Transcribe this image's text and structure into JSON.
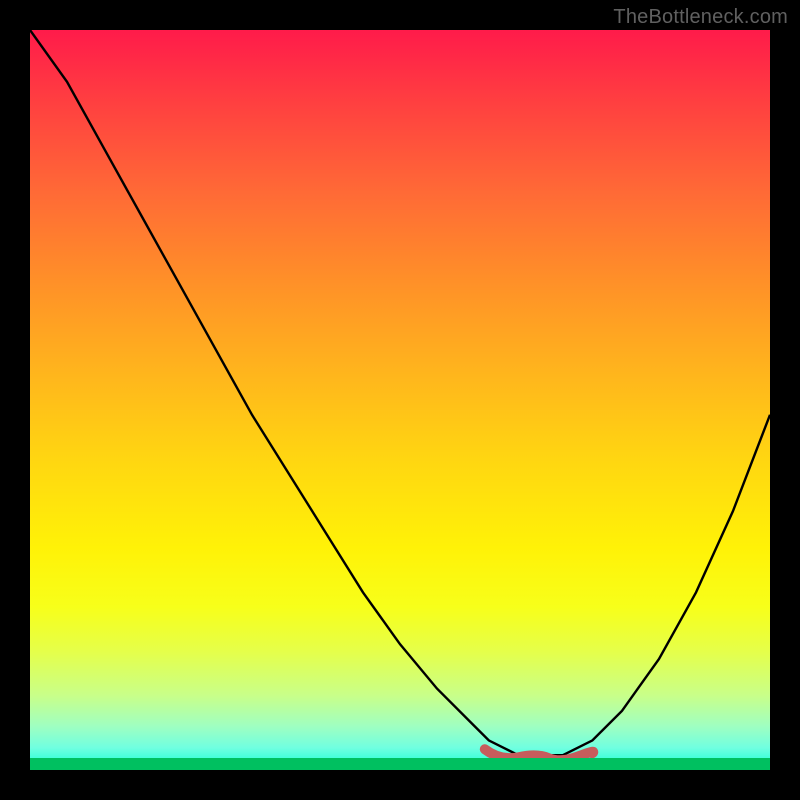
{
  "attribution": "TheBottleneck.com",
  "colors": {
    "background": "#000000",
    "curve": "#000000",
    "marker": "#c75c5c",
    "gradient_top": "#ff1b4a",
    "gradient_bottom": "#00e090"
  },
  "chart_data": {
    "type": "line",
    "title": "",
    "xlabel": "",
    "ylabel": "",
    "xlim": [
      0,
      100
    ],
    "ylim": [
      0,
      100
    ],
    "x": [
      0,
      5,
      10,
      15,
      20,
      25,
      30,
      35,
      40,
      45,
      50,
      55,
      60,
      62,
      64,
      66,
      68,
      70,
      72,
      74,
      76,
      80,
      85,
      90,
      95,
      100
    ],
    "y": [
      100,
      93,
      84,
      75,
      66,
      57,
      48,
      40,
      32,
      24,
      17,
      11,
      6,
      4,
      3,
      2,
      2,
      2,
      2,
      3,
      4,
      8,
      15,
      24,
      35,
      48
    ],
    "description": "Approximate V-shaped bottleneck curve: steep descent from top-left to a flat minimum around x=62-74, then rises toward the right. Y-axis represents bottleneck percentage (higher = worse, red; lower = better, green).",
    "marker_region": {
      "x_start": 62,
      "x_end": 76,
      "y": 2,
      "note": "Highlighted optimal range at the curve minimum"
    }
  }
}
